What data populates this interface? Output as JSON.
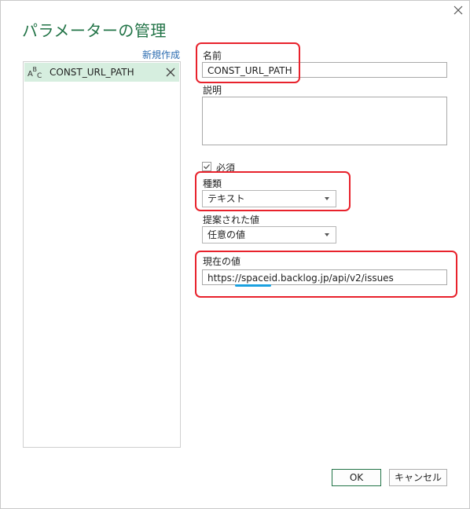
{
  "dialog": {
    "title": "パラメーターの管理"
  },
  "left_panel": {
    "new_label": "新規作成",
    "parameters": [
      {
        "type_icon": "abc-icon",
        "name": "CONST_URL_PATH"
      }
    ]
  },
  "form": {
    "name_label": "名前",
    "name_value": "CONST_URL_PATH",
    "description_label": "説明",
    "required_label": "必須",
    "required_checked": true,
    "type_label": "種類",
    "type_value": "テキスト",
    "suggested_label": "提案された値",
    "suggested_value": "任意の値",
    "current_label": "現在の値",
    "current_value": "https://spaceid.backlog.jp/api/v2/issues"
  },
  "buttons": {
    "ok": "OK",
    "cancel": "キャンセル"
  },
  "colors": {
    "title": "#217346",
    "link": "#2b6cb0",
    "selected_row": "#d6eedf",
    "highlight": "#e8222c",
    "underline": "#1aa1e0"
  }
}
